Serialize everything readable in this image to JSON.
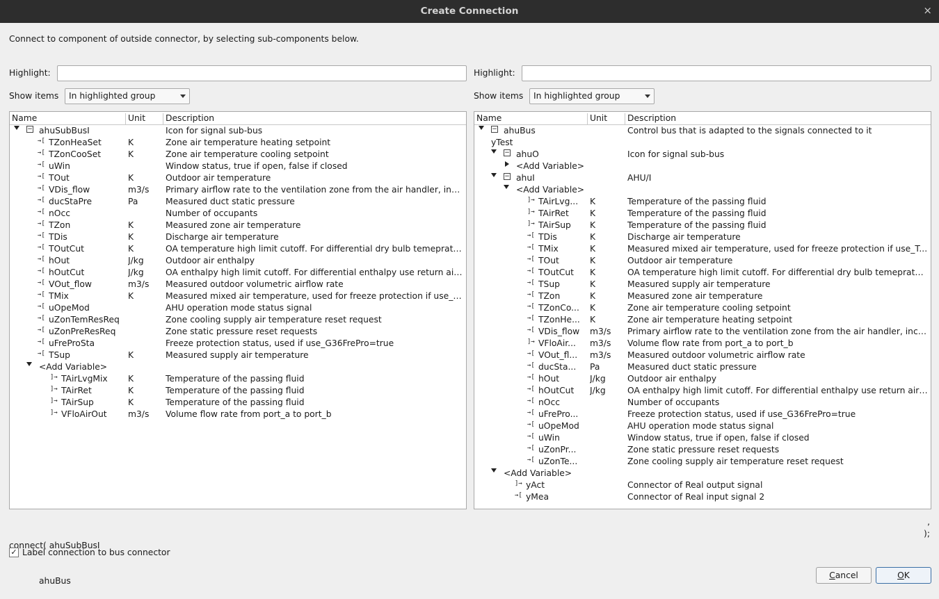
{
  "window": {
    "title": "Create Connection",
    "close_glyph": "×"
  },
  "intro": "Connect to component of outside connector, by selecting sub-components below.",
  "left": {
    "highlight_label": "Highlight:",
    "highlight_value": "",
    "show_items_label": "Show items",
    "show_items_value": "In highlighted group",
    "columns": {
      "name": "Name",
      "unit": "Unit",
      "description": "Description"
    },
    "rows": [
      {
        "name": "ahuSubBusI",
        "unit": "",
        "desc": "Icon for signal sub-bus",
        "depth": 0,
        "icon": "bus",
        "expander": "open"
      },
      {
        "name": "TZonHeaSet",
        "unit": "K",
        "desc": "Zone air temperature heating setpoint",
        "depth": 2,
        "icon": "in"
      },
      {
        "name": "TZonCooSet",
        "unit": "K",
        "desc": "Zone air temperature cooling setpoint",
        "depth": 2,
        "icon": "in"
      },
      {
        "name": "uWin",
        "unit": "",
        "desc": "Window status, true if open, false if closed",
        "depth": 2,
        "icon": "in"
      },
      {
        "name": "TOut",
        "unit": "K",
        "desc": "Outdoor air temperature",
        "depth": 2,
        "icon": "in"
      },
      {
        "name": "VDis_flow",
        "unit": "m3/s",
        "desc": "Primary airflow rate to the ventilation zone from the air handler, incl...",
        "depth": 2,
        "icon": "in"
      },
      {
        "name": "ducStaPre",
        "unit": "Pa",
        "desc": "Measured duct static pressure",
        "depth": 2,
        "icon": "in"
      },
      {
        "name": "nOcc",
        "unit": "",
        "desc": "Number of occupants",
        "depth": 2,
        "icon": "in"
      },
      {
        "name": "TZon",
        "unit": "K",
        "desc": "Measured zone air temperature",
        "depth": 2,
        "icon": "in"
      },
      {
        "name": "TDis",
        "unit": "K",
        "desc": "Discharge air temperature",
        "depth": 2,
        "icon": "in"
      },
      {
        "name": "TOutCut",
        "unit": "K",
        "desc": "OA temperature high limit cutoff. For differential dry bulb temepratu...",
        "depth": 2,
        "icon": "in"
      },
      {
        "name": "hOut",
        "unit": "J/kg",
        "desc": "Outdoor air enthalpy",
        "depth": 2,
        "icon": "in"
      },
      {
        "name": "hOutCut",
        "unit": "J/kg",
        "desc": "OA enthalpy high limit cutoff. For differential enthalpy use return air ...",
        "depth": 2,
        "icon": "in"
      },
      {
        "name": "VOut_flow",
        "unit": "m3/s",
        "desc": "Measured outdoor volumetric airflow rate",
        "depth": 2,
        "icon": "in"
      },
      {
        "name": "TMix",
        "unit": "K",
        "desc": "Measured mixed air temperature, used for freeze protection if use_T...",
        "depth": 2,
        "icon": "in"
      },
      {
        "name": "uOpeMod",
        "unit": "",
        "desc": "AHU operation mode status signal",
        "depth": 2,
        "icon": "in"
      },
      {
        "name": "uZonTemResReq",
        "unit": "",
        "desc": "Zone cooling supply air temperature reset request",
        "depth": 2,
        "icon": "in"
      },
      {
        "name": "uZonPreResReq",
        "unit": "",
        "desc": "Zone static pressure reset requests",
        "depth": 2,
        "icon": "in"
      },
      {
        "name": "uFreProSta",
        "unit": "",
        "desc": "Freeze protection status, used if use_G36FrePro=true",
        "depth": 2,
        "icon": "in"
      },
      {
        "name": "TSup",
        "unit": "K",
        "desc": "Measured supply air temperature",
        "depth": 2,
        "icon": "in"
      },
      {
        "name": "<Add Variable>",
        "unit": "",
        "desc": "",
        "depth": 1,
        "icon": "none",
        "expander": "open"
      },
      {
        "name": "TAirLvgMix",
        "unit": "K",
        "desc": "Temperature of the passing fluid",
        "depth": 3,
        "icon": "out"
      },
      {
        "name": "TAirRet",
        "unit": "K",
        "desc": "Temperature of the passing fluid",
        "depth": 3,
        "icon": "out"
      },
      {
        "name": "TAirSup",
        "unit": "K",
        "desc": "Temperature of the passing fluid",
        "depth": 3,
        "icon": "out"
      },
      {
        "name": "VFloAirOut",
        "unit": "m3/s",
        "desc": "Volume flow rate from port_a to port_b",
        "depth": 3,
        "icon": "out"
      }
    ]
  },
  "right": {
    "highlight_label": "Highlight:",
    "highlight_value": "",
    "show_items_label": "Show items",
    "show_items_value": "In highlighted group",
    "columns": {
      "name": "Name",
      "unit": "Unit",
      "description": "Description"
    },
    "rows": [
      {
        "name": "ahuBus",
        "unit": "",
        "desc": "Control bus that is adapted to the signals connected to it",
        "depth": 0,
        "icon": "bus",
        "expander": "open"
      },
      {
        "name": "yTest",
        "unit": "",
        "desc": "",
        "depth": 1,
        "icon": "none"
      },
      {
        "name": "ahuO",
        "unit": "",
        "desc": "Icon for signal sub-bus",
        "depth": 1,
        "icon": "bus",
        "expander": "open"
      },
      {
        "name": "<Add Variable>",
        "unit": "",
        "desc": "",
        "depth": 2,
        "icon": "none",
        "expander": "closed"
      },
      {
        "name": "ahuI",
        "unit": "",
        "desc": "AHU/I",
        "depth": 1,
        "icon": "bus",
        "expander": "open"
      },
      {
        "name": "<Add Variable>",
        "unit": "",
        "desc": "",
        "depth": 2,
        "icon": "none",
        "expander": "open"
      },
      {
        "name": "TAirLvg...",
        "unit": "K",
        "desc": "Temperature of the passing fluid",
        "depth": 4,
        "icon": "out"
      },
      {
        "name": "TAirRet",
        "unit": "K",
        "desc": "Temperature of the passing fluid",
        "depth": 4,
        "icon": "out"
      },
      {
        "name": "TAirSup",
        "unit": "K",
        "desc": "Temperature of the passing fluid",
        "depth": 4,
        "icon": "out"
      },
      {
        "name": "TDis",
        "unit": "K",
        "desc": "Discharge air temperature",
        "depth": 4,
        "icon": "in"
      },
      {
        "name": "TMix",
        "unit": "K",
        "desc": "Measured mixed air temperature, used for freeze protection if use_T...",
        "depth": 4,
        "icon": "in"
      },
      {
        "name": "TOut",
        "unit": "K",
        "desc": "Outdoor air temperature",
        "depth": 4,
        "icon": "in"
      },
      {
        "name": "TOutCut",
        "unit": "K",
        "desc": "OA temperature high limit cutoff. For differential dry bulb temepratu...",
        "depth": 4,
        "icon": "in"
      },
      {
        "name": "TSup",
        "unit": "K",
        "desc": "Measured supply air temperature",
        "depth": 4,
        "icon": "in"
      },
      {
        "name": "TZon",
        "unit": "K",
        "desc": "Measured zone air temperature",
        "depth": 4,
        "icon": "in"
      },
      {
        "name": "TZonCo...",
        "unit": "K",
        "desc": "Zone air temperature cooling setpoint",
        "depth": 4,
        "icon": "in"
      },
      {
        "name": "TZonHe...",
        "unit": "K",
        "desc": "Zone air temperature heating setpoint",
        "depth": 4,
        "icon": "in"
      },
      {
        "name": "VDis_flow",
        "unit": "m3/s",
        "desc": "Primary airflow rate to the ventilation zone from the air handler, inclu...",
        "depth": 4,
        "icon": "in"
      },
      {
        "name": "VFloAir...",
        "unit": "m3/s",
        "desc": "Volume flow rate from port_a to port_b",
        "depth": 4,
        "icon": "out"
      },
      {
        "name": "VOut_fl...",
        "unit": "m3/s",
        "desc": "Measured outdoor volumetric airflow rate",
        "depth": 4,
        "icon": "in"
      },
      {
        "name": "ducSta...",
        "unit": "Pa",
        "desc": "Measured duct static pressure",
        "depth": 4,
        "icon": "in"
      },
      {
        "name": "hOut",
        "unit": "J/kg",
        "desc": "Outdoor air enthalpy",
        "depth": 4,
        "icon": "in"
      },
      {
        "name": "hOutCut",
        "unit": "J/kg",
        "desc": "OA enthalpy high limit cutoff. For differential enthalpy use return air ...",
        "depth": 4,
        "icon": "in"
      },
      {
        "name": "nOcc",
        "unit": "",
        "desc": "Number of occupants",
        "depth": 4,
        "icon": "in"
      },
      {
        "name": "uFrePro...",
        "unit": "",
        "desc": "Freeze protection status, used if use_G36FrePro=true",
        "depth": 4,
        "icon": "in"
      },
      {
        "name": "uOpeMod",
        "unit": "",
        "desc": "AHU operation mode status signal",
        "depth": 4,
        "icon": "in"
      },
      {
        "name": "uWin",
        "unit": "",
        "desc": "Window status, true if open, false if closed",
        "depth": 4,
        "icon": "in"
      },
      {
        "name": "uZonPr...",
        "unit": "",
        "desc": "Zone static pressure reset requests",
        "depth": 4,
        "icon": "in"
      },
      {
        "name": "uZonTe...",
        "unit": "",
        "desc": "Zone cooling supply air temperature reset request",
        "depth": 4,
        "icon": "in"
      },
      {
        "name": "<Add Variable>",
        "unit": "",
        "desc": "",
        "depth": 1,
        "icon": "none",
        "expander": "open"
      },
      {
        "name": "yAct",
        "unit": "",
        "desc": "Connector of Real output signal",
        "depth": 3,
        "icon": "out"
      },
      {
        "name": "yMea",
        "unit": "",
        "desc": "Connector of Real input signal 2",
        "depth": 3,
        "icon": "in"
      }
    ]
  },
  "connect": {
    "line1": "connect( ahuSubBusI",
    "line2": "           ahuBus",
    "comma": ",",
    "close": ");"
  },
  "label_checkbox": {
    "label": "Label connection to bus connector",
    "checked": true,
    "glyph": "✓"
  },
  "buttons": {
    "cancel": "Cancel",
    "ok": "OK"
  }
}
